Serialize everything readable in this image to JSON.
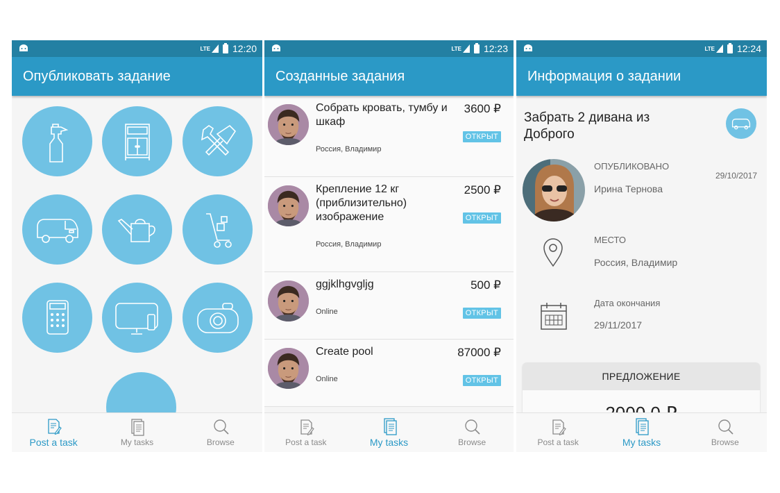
{
  "colors": {
    "statusbar": "#2380a3",
    "appbar": "#2b99c6",
    "category_circle": "#70c2e4",
    "badge": "#62c3e6",
    "nav_active": "#2b99c6",
    "nav_inactive": "#8a8a8a"
  },
  "phones": [
    {
      "status": {
        "time": "12:20",
        "network": "LTE"
      },
      "title": "Опубликовать задание",
      "categories": [
        {
          "icon": "spray-bottle-icon"
        },
        {
          "icon": "cabinet-icon"
        },
        {
          "icon": "tools-icon"
        },
        {
          "icon": "van-icon"
        },
        {
          "icon": "watering-can-icon"
        },
        {
          "icon": "hand-cart-icon"
        },
        {
          "icon": "calculator-icon"
        },
        {
          "icon": "computer-icon"
        },
        {
          "icon": "camera-icon"
        },
        {
          "icon": "more-category-icon"
        }
      ],
      "nav": [
        {
          "label": "Post a task",
          "icon": "post-task-icon",
          "active": true
        },
        {
          "label": "My tasks",
          "icon": "my-tasks-icon",
          "active": false
        },
        {
          "label": "Browse",
          "icon": "browse-icon",
          "active": false
        }
      ]
    },
    {
      "status": {
        "time": "12:23",
        "network": "LTE"
      },
      "title": "Созданные задания",
      "tasks": [
        {
          "title": "Собрать кровать, тумбу и шкаф",
          "price": "3600 ₽",
          "status": "ОТКРЫТ",
          "location": "Россия, Владимир"
        },
        {
          "title": "Крепление 12 кг (приблизительно) изображение",
          "price": "2500 ₽",
          "status": "ОТКРЫТ",
          "location": "Россия, Владимир"
        },
        {
          "title": "ggjklhgvgljg",
          "price": "500 ₽",
          "status": "ОТКРЫТ",
          "location": "Online"
        },
        {
          "title": "Create pool",
          "price": "87000 ₽",
          "status": "ОТКРЫТ",
          "location": "Online"
        }
      ],
      "nav": [
        {
          "label": "Post a task",
          "icon": "post-task-icon",
          "active": false
        },
        {
          "label": "My tasks",
          "icon": "my-tasks-icon",
          "active": true
        },
        {
          "label": "Browse",
          "icon": "browse-icon",
          "active": false
        }
      ]
    },
    {
      "status": {
        "time": "12:24",
        "network": "LTE"
      },
      "title": "Информация о задании",
      "task_title": "Забрать 2 дивана из Доброго",
      "published_label": "ОПУБЛИКОВАНО",
      "published_date": "29/10/2017",
      "author": "Ирина Тернова",
      "place_label": "МЕСТО",
      "place": "Россия, Владимир",
      "deadline_label": "Дата окончания",
      "deadline": "29/11/2017",
      "offer_header": "ПРЕДЛОЖЕНИЕ",
      "offer_amount": "2000,0 ₽",
      "nav": [
        {
          "label": "Post a task",
          "icon": "post-task-icon",
          "active": false
        },
        {
          "label": "My tasks",
          "icon": "my-tasks-icon",
          "active": true
        },
        {
          "label": "Browse",
          "icon": "browse-icon",
          "active": false
        }
      ]
    }
  ]
}
